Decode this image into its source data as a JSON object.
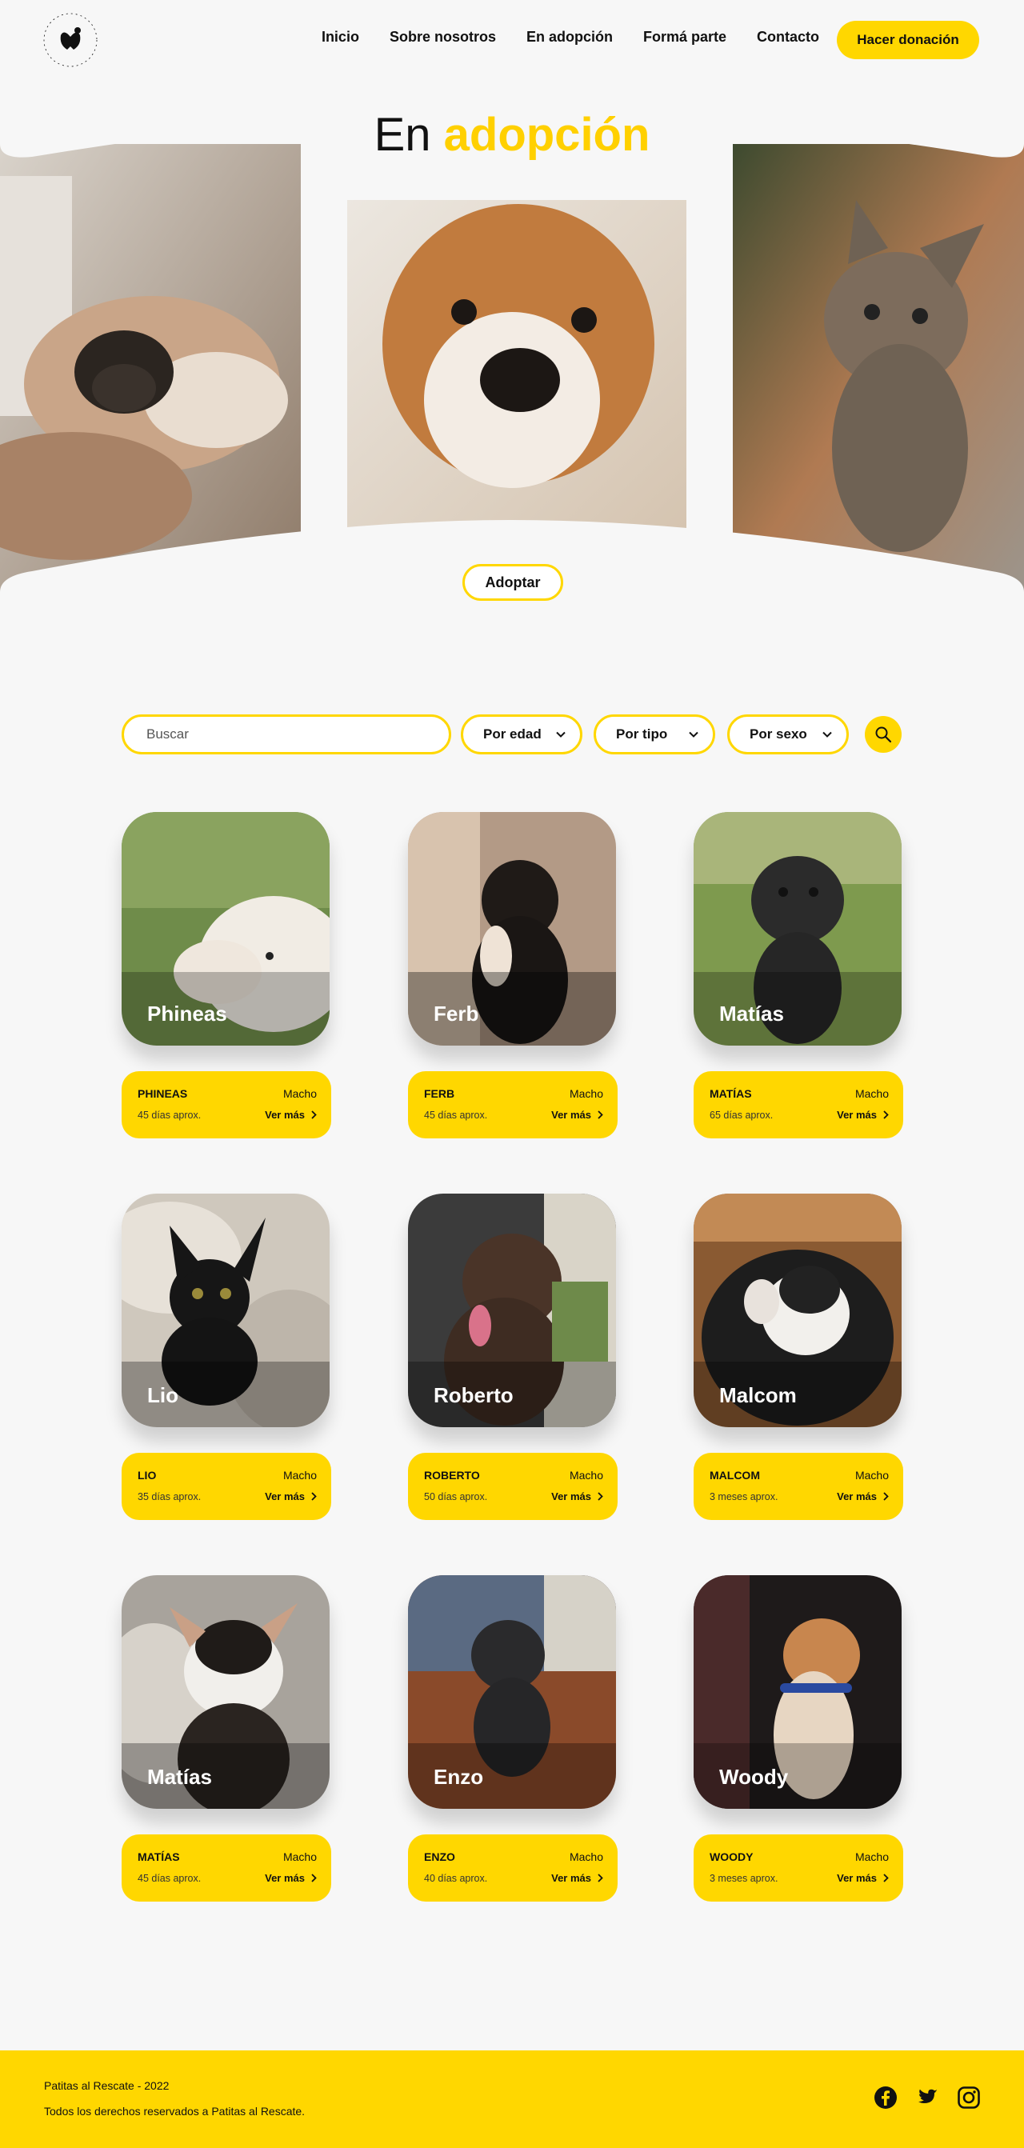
{
  "brand": {
    "logo_alt": "Patitas al Rescate"
  },
  "nav": {
    "items": [
      "Inicio",
      "Sobre nosotros",
      "En adopción",
      "Formá parte",
      "Contacto"
    ],
    "donate_label": "Hacer donación"
  },
  "hero": {
    "title_plain": "En",
    "title_highlight": "adopción",
    "adopt_label": "Adoptar"
  },
  "filters": {
    "search_placeholder": "Buscar",
    "age_label": "Por edad",
    "type_label": "Por tipo",
    "sex_label": "Por sexo"
  },
  "pets": [
    {
      "name": "Phineas",
      "name_upper": "PHINEAS",
      "sex": "Macho",
      "age": "45 días aprox.",
      "more": "Ver más"
    },
    {
      "name": "Ferb",
      "name_upper": "FERB",
      "sex": "Macho",
      "age": "45 días aprox.",
      "more": "Ver más"
    },
    {
      "name": "Matías",
      "name_upper": "MATÍAS",
      "sex": "Macho",
      "age": "65 días aprox.",
      "more": "Ver más"
    },
    {
      "name": "Lio",
      "name_upper": "LIO",
      "sex": "Macho",
      "age": "35 días aprox.",
      "more": "Ver más"
    },
    {
      "name": "Roberto",
      "name_upper": "ROBERTO",
      "sex": "Macho",
      "age": "50 días aprox.",
      "more": "Ver más"
    },
    {
      "name": "Malcom",
      "name_upper": "MALCOM",
      "sex": "Macho",
      "age": "3 meses aprox.",
      "more": "Ver más"
    },
    {
      "name": "Matías",
      "name_upper": "MATÍAS",
      "sex": "Macho",
      "age": "45 días aprox.",
      "more": "Ver más"
    },
    {
      "name": "Enzo",
      "name_upper": "ENZO",
      "sex": "Macho",
      "age": "40 días aprox.",
      "more": "Ver más"
    },
    {
      "name": "Woody",
      "name_upper": "WOODY",
      "sex": "Macho",
      "age": "3 meses aprox.",
      "more": "Ver más"
    }
  ],
  "footer": {
    "line1": "Patitas al Rescate - 2022",
    "line2": "Todos los derechos reservados a Patitas al Rescate."
  },
  "colors": {
    "accent": "#ffd700",
    "background": "#f7f7f7"
  },
  "icons": [
    "logo-icon",
    "chevron-down-icon",
    "search-icon",
    "chevron-right-icon",
    "facebook-icon",
    "twitter-icon",
    "instagram-icon"
  ]
}
